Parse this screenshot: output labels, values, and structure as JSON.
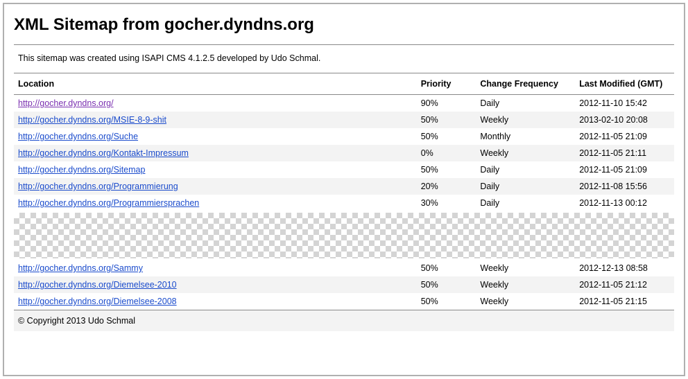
{
  "title": "XML Sitemap from gocher.dyndns.org",
  "intro": "This sitemap was created using ISAPI CMS 4.1.2.5 developed by Udo Schmal.",
  "table": {
    "headers": {
      "location": "Location",
      "priority": "Priority",
      "change_frequency": "Change Frequency",
      "last_modified": "Last Modified (GMT)"
    },
    "rows_top": [
      {
        "url": "http://gocher.dyndns.org/",
        "priority": "90%",
        "freq": "Daily",
        "modified": "2012-11-10 15:42",
        "visited": true
      },
      {
        "url": "http://gocher.dyndns.org/MSIE-8-9-shit",
        "priority": "50%",
        "freq": "Weekly",
        "modified": "2013-02-10 20:08",
        "visited": false
      },
      {
        "url": "http://gocher.dyndns.org/Suche",
        "priority": "50%",
        "freq": "Monthly",
        "modified": "2012-11-05 21:09",
        "visited": false
      },
      {
        "url": "http://gocher.dyndns.org/Kontakt-Impressum",
        "priority": "0%",
        "freq": "Weekly",
        "modified": "2012-11-05 21:11",
        "visited": false
      },
      {
        "url": "http://gocher.dyndns.org/Sitemap",
        "priority": "50%",
        "freq": "Daily",
        "modified": "2012-11-05 21:09",
        "visited": false
      },
      {
        "url": "http://gocher.dyndns.org/Programmierung",
        "priority": "20%",
        "freq": "Daily",
        "modified": "2012-11-08 15:56",
        "visited": false
      },
      {
        "url": "http://gocher.dyndns.org/Programmiersprachen",
        "priority": "30%",
        "freq": "Daily",
        "modified": "2012-11-13 00:12",
        "visited": false
      }
    ],
    "rows_bottom": [
      {
        "url": "http://gocher.dyndns.org/Sammy",
        "priority": "50%",
        "freq": "Weekly",
        "modified": "2012-12-13 08:58",
        "visited": false
      },
      {
        "url": "http://gocher.dyndns.org/Diemelsee-2010",
        "priority": "50%",
        "freq": "Weekly",
        "modified": "2012-11-05 21:12",
        "visited": false
      },
      {
        "url": "http://gocher.dyndns.org/Diemelsee-2008",
        "priority": "50%",
        "freq": "Weekly",
        "modified": "2012-11-05 21:15",
        "visited": false
      }
    ]
  },
  "footer": "© Copyright 2013 Udo Schmal"
}
